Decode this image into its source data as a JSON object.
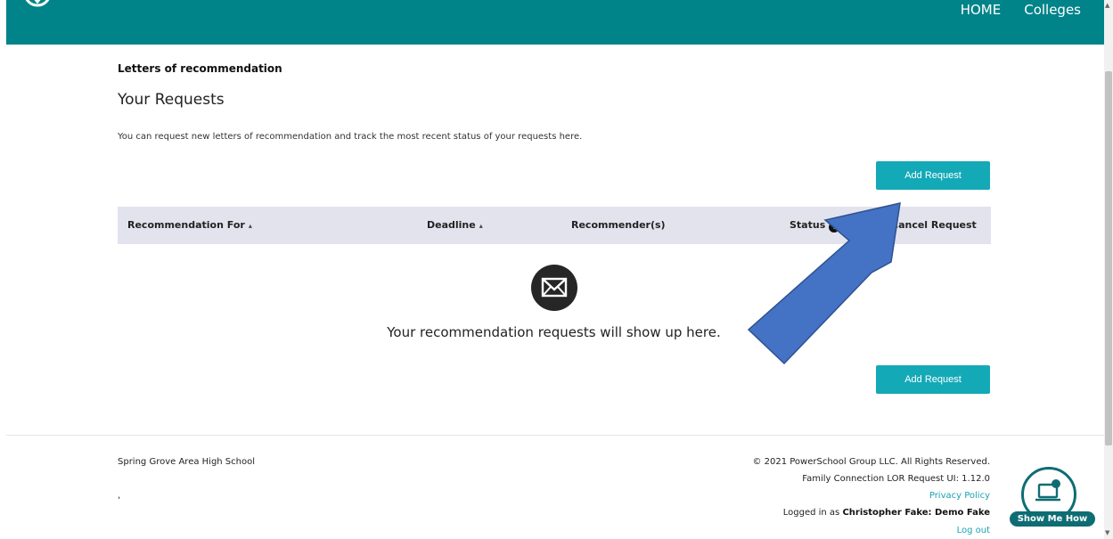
{
  "nav": {
    "home": "HOME",
    "colleges": "Colleges"
  },
  "breadcrumb": "Letters of recommendation",
  "page_title": "Your Requests",
  "intro_text": "You can request new letters of recommendation and track the most recent status of your requests here.",
  "add_request_label": "Add Request",
  "table": {
    "columns": {
      "recommendation_for": "Recommendation For",
      "deadline": "Deadline",
      "recommenders": "Recommender(s)",
      "status": "Status",
      "cancel_request": "Cancel Request"
    },
    "sort_glyph": "▴",
    "info_glyph": "i",
    "empty_message": "Your recommendation requests will show up here."
  },
  "footer": {
    "school": "Spring Grove Area High School",
    "comma": ",",
    "copyright": "© 2021 PowerSchool Group LLC. All Rights Reserved.",
    "version": "Family Connection LOR Request UI: 1.12.0",
    "privacy": "Privacy Policy",
    "logged_in_prefix": "Logged in as ",
    "user": "Christopher Fake: Demo Fake",
    "logout": "Log out"
  },
  "help_widget": {
    "label": "Show Me How"
  },
  "icons": {
    "logo": "school-logo-icon",
    "mail": "envelope-icon",
    "info": "info-icon",
    "help": "laptop-help-icon",
    "annotation": "blue-arrow-icon"
  },
  "colors": {
    "header": "#008389",
    "button": "#14a9b7",
    "table_header": "#e3e3ee",
    "link": "#1ba3b3",
    "arrow": "#4472c4",
    "help": "#0e6d73"
  }
}
